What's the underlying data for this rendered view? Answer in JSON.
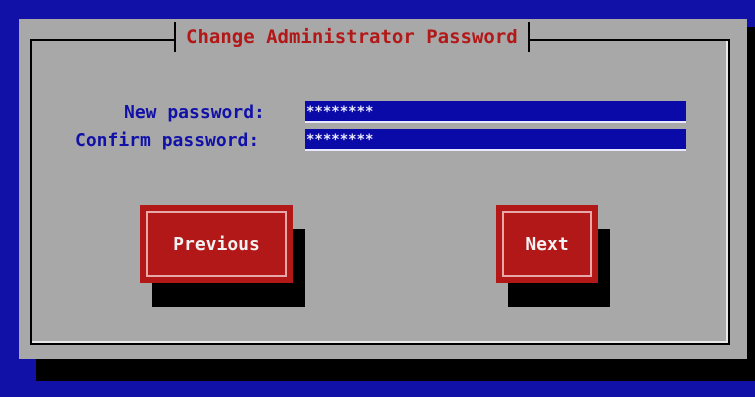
{
  "dialog": {
    "title": "Change Administrator Password"
  },
  "form": {
    "new_password": {
      "label": "New password:",
      "value": "********"
    },
    "confirm_password": {
      "label": "Confirm password:",
      "value": "********"
    }
  },
  "buttons": {
    "previous_label": "Previous",
    "next_label": "Next"
  },
  "colors": {
    "background": "#1111a8",
    "dialog": "#a8a8a8",
    "title": "#b21818",
    "label": "#1111a8",
    "input_bg": "#0a0aa8",
    "button": "#b21818"
  }
}
